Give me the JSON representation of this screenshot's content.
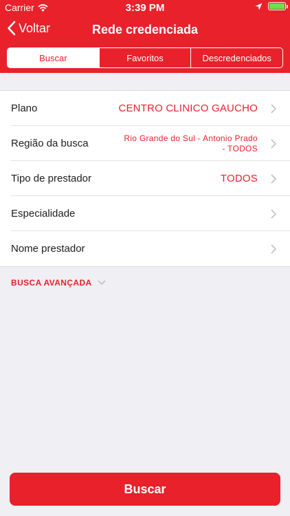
{
  "status_bar": {
    "carrier": "Carrier",
    "time": "3:39 PM"
  },
  "nav": {
    "back_label": "Voltar",
    "title": "Rede credenciada"
  },
  "tabs": [
    {
      "label": "Buscar",
      "active": true
    },
    {
      "label": "Favoritos",
      "active": false
    },
    {
      "label": "Descredenciados",
      "active": false
    }
  ],
  "form": {
    "rows": [
      {
        "label": "Plano",
        "value": "CENTRO CLINICO GAUCHO"
      },
      {
        "label": "Região da busca",
        "value": "Rio Grande do Sul - Antonio Prado -  TODOS"
      },
      {
        "label": "Tipo de prestador",
        "value": "TODOS"
      },
      {
        "label": "Especialidade",
        "value": ""
      },
      {
        "label": "Nome prestador",
        "value": ""
      }
    ]
  },
  "advanced": {
    "label": "BUSCA AVANÇADA"
  },
  "action": {
    "label": "Buscar"
  },
  "colors": {
    "accent": "#e8212b",
    "background": "#efeff4",
    "battery": "#6ee04a"
  },
  "icons": [
    "wifi-icon",
    "location-arrow-icon",
    "battery-icon",
    "chevron-left-icon",
    "chevron-right-icon",
    "chevron-down-icon"
  ]
}
